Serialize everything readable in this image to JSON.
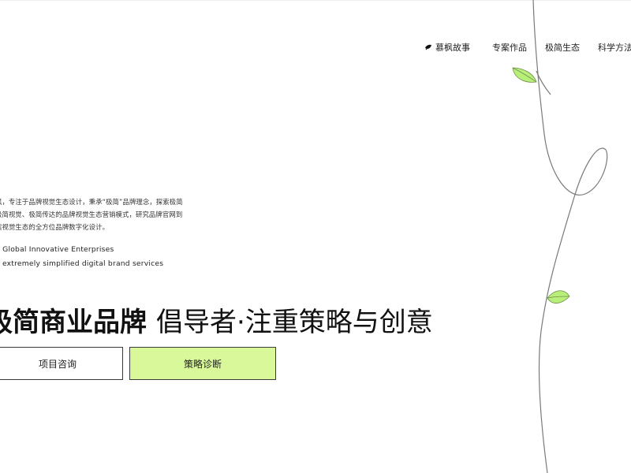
{
  "nav": {
    "items": [
      {
        "label": "慕枫故事",
        "icon": "leaf-logo-icon"
      },
      {
        "label": "专案作品"
      },
      {
        "label": "极简生态"
      },
      {
        "label": "科学方法"
      }
    ]
  },
  "hero": {
    "intro_lines": [
      "枫，专注于品牌视觉生态设计，秉承“极简”品牌理念，探索极简",
      "极简视觉、极简传达的品牌视觉生态营销模式，研究品牌官网到",
      "案视觉生态的全方位品牌数字化设计。"
    ],
    "english_line_1": "g Global Innovative Enterprises",
    "english_line_2": "e extremely simplified digital brand services",
    "headline_bold": "极简商业品牌",
    "headline_light": "倡导者·注重策略与创意"
  },
  "buttons": {
    "consult": "项目咨询",
    "diagnosis": "策略诊断"
  },
  "colors": {
    "accent": "#d8f89a",
    "leaf": "#b8ee7a",
    "text": "#222222"
  }
}
